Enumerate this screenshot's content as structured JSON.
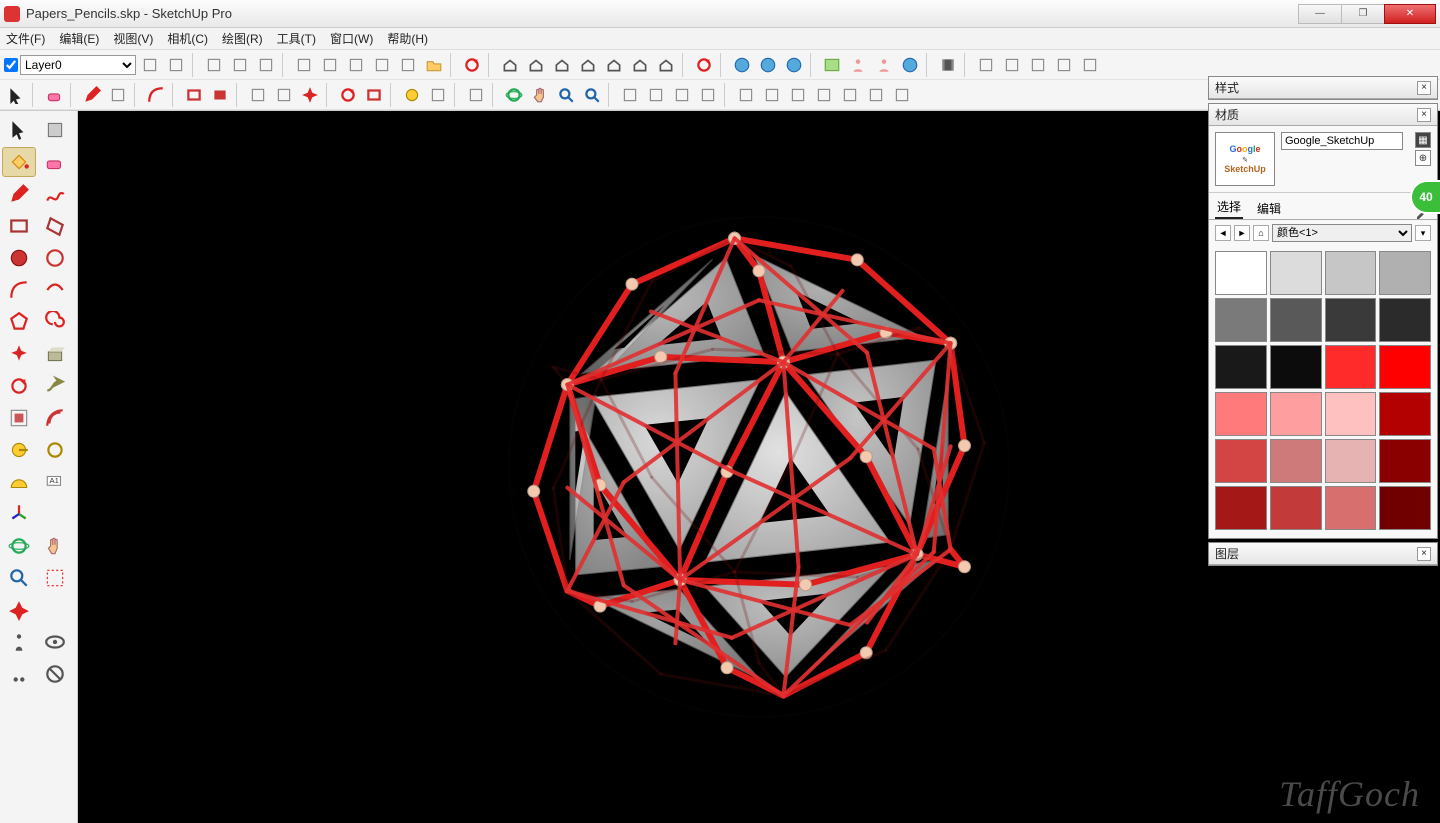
{
  "title": "Papers_Pencils.skp - SketchUp Pro",
  "menu": [
    "文件(F)",
    "编辑(E)",
    "视图(V)",
    "相机(C)",
    "绘图(R)",
    "工具(T)",
    "窗口(W)",
    "帮助(H)"
  ],
  "layer_current": "Layer0",
  "badge": "40",
  "watermark": "TaffGoch",
  "panels": {
    "styles": {
      "title": "样式"
    },
    "materials": {
      "title": "材质",
      "name_value": "Google_SketchUp",
      "thumb_line1": "Google",
      "thumb_line2": "SketchUp",
      "tabs": [
        "选择",
        "编辑"
      ],
      "active_tab": 0,
      "set_select": "颜色<1>",
      "swatches": [
        "#ffffff",
        "#dcdcdc",
        "#c6c6c6",
        "#b0b0b0",
        "#7a7a7a",
        "#595959",
        "#3a3a3a",
        "#2b2b2b",
        "#191919",
        "#0c0c0c",
        "#ff2a2a",
        "#ff0000",
        "#ff7a7a",
        "#ff9e9e",
        "#ffc0c0",
        "#b30000",
        "#d34545",
        "#cf7a7a",
        "#e7b2b2",
        "#8a0000",
        "#a51818",
        "#c23a3a",
        "#d86f6f",
        "#700000"
      ]
    },
    "layers": {
      "title": "图层"
    }
  },
  "left_tools": [
    [
      "select-arrow",
      "shape-builder"
    ],
    [
      "paint-bucket",
      "eraser"
    ],
    [
      "pencil",
      "freehand"
    ],
    [
      "rectangle",
      "rect-rot"
    ],
    [
      "circle",
      "circle-2"
    ],
    [
      "arc",
      "arc-2"
    ],
    [
      "polygon",
      "spiral"
    ],
    [
      "move-rose",
      "push-pull"
    ],
    [
      "rotate",
      "follow-me"
    ],
    [
      "scale",
      "offset"
    ],
    [
      "tape",
      "tape-2"
    ],
    [
      "protractor",
      "text"
    ],
    [
      "axes",
      "-"
    ],
    [
      "orbit",
      "pan-hand"
    ],
    [
      "zoom",
      "zoom-window"
    ],
    [
      "zoom-extents",
      "-"
    ],
    [
      "person",
      "eye"
    ],
    [
      "walk",
      "section"
    ]
  ],
  "top_icons_row1": [
    "toggle-layer",
    "layer-opts",
    "|",
    "proj-1",
    "proj-2",
    "proj-3",
    "|",
    "folder-1",
    "folder-2",
    "folder-3",
    "folder-4",
    "folder-5",
    "folder-stack",
    "|",
    "refresh",
    "|",
    "house-iso",
    "house-top",
    "house-front",
    "house-side",
    "house-back",
    "house-right",
    "house-bottom",
    "|",
    "rotate-cam",
    "|",
    "globe",
    "sphere-grid",
    "sphere-shade",
    "|",
    "map",
    "people",
    "head",
    "cloud",
    "|",
    "film",
    "|",
    "window-1",
    "window-2",
    "window-3",
    "window-4",
    "window-5"
  ],
  "top_icons_row2": [
    "pointer",
    "|",
    "eraser-red",
    "|",
    "pencil-red",
    "pencil-dd",
    "|",
    "arc-red",
    "|",
    "rect-outline",
    "rect-solid",
    "|",
    "vertex-1",
    "vertex-2",
    "compass-rose",
    "|",
    "rot-red",
    "rect-rot",
    "|",
    "tape-y",
    "dim",
    "|",
    "glass-1",
    "|",
    "orbit-green",
    "pan-hand",
    "zoom",
    "zoom-ext",
    "|",
    "layers",
    "shadow",
    "fog",
    "outliner",
    "|",
    "comp-1",
    "comp-2",
    "comp-3",
    "comp-4",
    "comp-5",
    "comp-6",
    "comp-7"
  ]
}
